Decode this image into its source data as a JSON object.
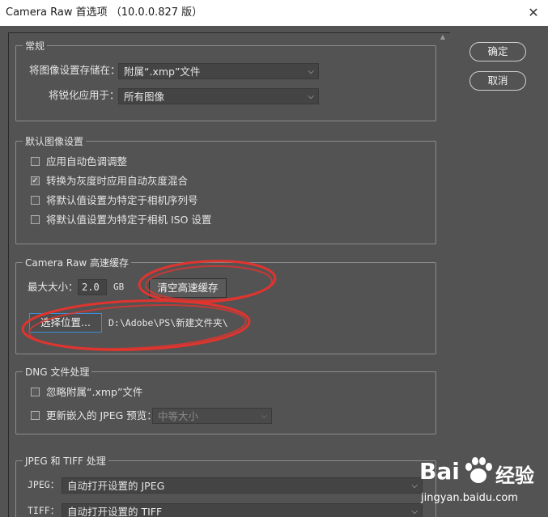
{
  "window": {
    "title": "Camera Raw 首选项 （10.0.0.827 版）",
    "close_symbol": "✕"
  },
  "buttons": {
    "ok": "确定",
    "cancel": "取消"
  },
  "general": {
    "legend": "常规",
    "save_label": "将图像设置存储在：",
    "save_value": "附属“.xmp”文件",
    "sharpen_label": "将锐化应用于：",
    "sharpen_value": "所有图像"
  },
  "defaults": {
    "legend": "默认图像设置",
    "items": [
      {
        "label": "应用自动色调调整",
        "checked": false
      },
      {
        "label": "转换为灰度时应用自动灰度混合",
        "checked": true
      },
      {
        "label": "将默认值设置为特定于相机序列号",
        "checked": false
      },
      {
        "label": "将默认值设置为特定于相机 ISO 设置",
        "checked": false
      }
    ]
  },
  "cache": {
    "legend": "Camera Raw 高速缓存",
    "max_size_label": "最大大小：",
    "max_size_value": "2.0",
    "unit": "GB",
    "purge_button": "清空高速缓存",
    "select_location_button": "选择位置...",
    "path": "D:\\Adobe\\PS\\新建文件夹\\"
  },
  "dng": {
    "legend": "DNG 文件处理",
    "ignore_label": "忽略附属“.xmp”文件",
    "update_label": "更新嵌入的 JPEG 预览：",
    "preview_value": "中等大小"
  },
  "jpeg_tiff": {
    "legend": "JPEG 和 TIFF 处理",
    "jpeg_label": "JPEG：",
    "jpeg_value": "自动打开设置的 JPEG",
    "tiff_label": "TIFF：",
    "tiff_value": "自动打开设置的 TIFF"
  },
  "watermark": {
    "brand": "Bai",
    "brand2": "经验",
    "url": "jingyan.baidu.com"
  },
  "colors": {
    "annotation": "#e0342f",
    "panel": "#535353",
    "focus": "#3b8ed8"
  }
}
